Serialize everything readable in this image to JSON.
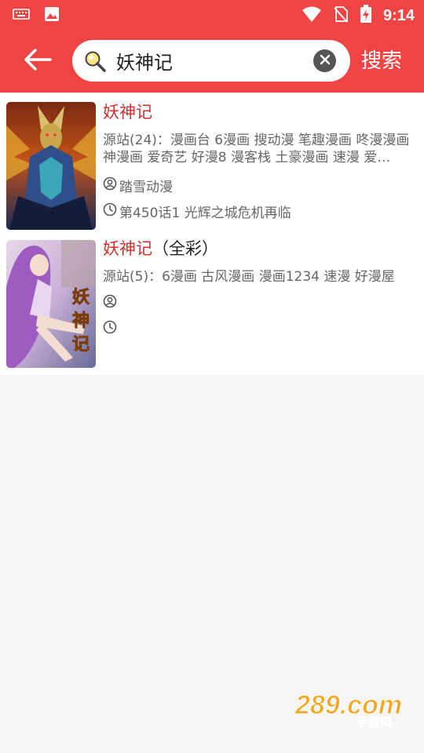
{
  "status_bar": {
    "time": "9:14",
    "icons": [
      "keyboard-icon",
      "image-icon",
      "wifi-icon",
      "no-sim-icon",
      "battery-charging-icon"
    ]
  },
  "app_bar": {
    "back_icon": "arrow-left-icon",
    "search": {
      "value": "妖神记",
      "placeholder": ""
    },
    "search_label": "搜索",
    "colors": {
      "primary": "#ef4444",
      "highlight": "#d32f2f",
      "secondary_text": "#666666"
    }
  },
  "results": [
    {
      "title_highlight": "妖神记",
      "title_rest": "",
      "sources": "源站(24)：漫画台 6漫画 搜动漫 笔趣漫画 咚漫漫画 神漫画 爱奇艺 好漫8 漫客栈 土豪漫画 速漫 爱…",
      "author": "踏雪动漫",
      "latest": "第450话1 光辉之城危机再临"
    },
    {
      "title_highlight": "妖神记",
      "title_rest": "（全彩）",
      "sources": "源站(5)：6漫画 古风漫画 漫画1234 速漫 好漫屋",
      "author": "",
      "latest": ""
    }
  ],
  "watermark": {
    "logo": "289.com",
    "subtitle": "手游网"
  }
}
